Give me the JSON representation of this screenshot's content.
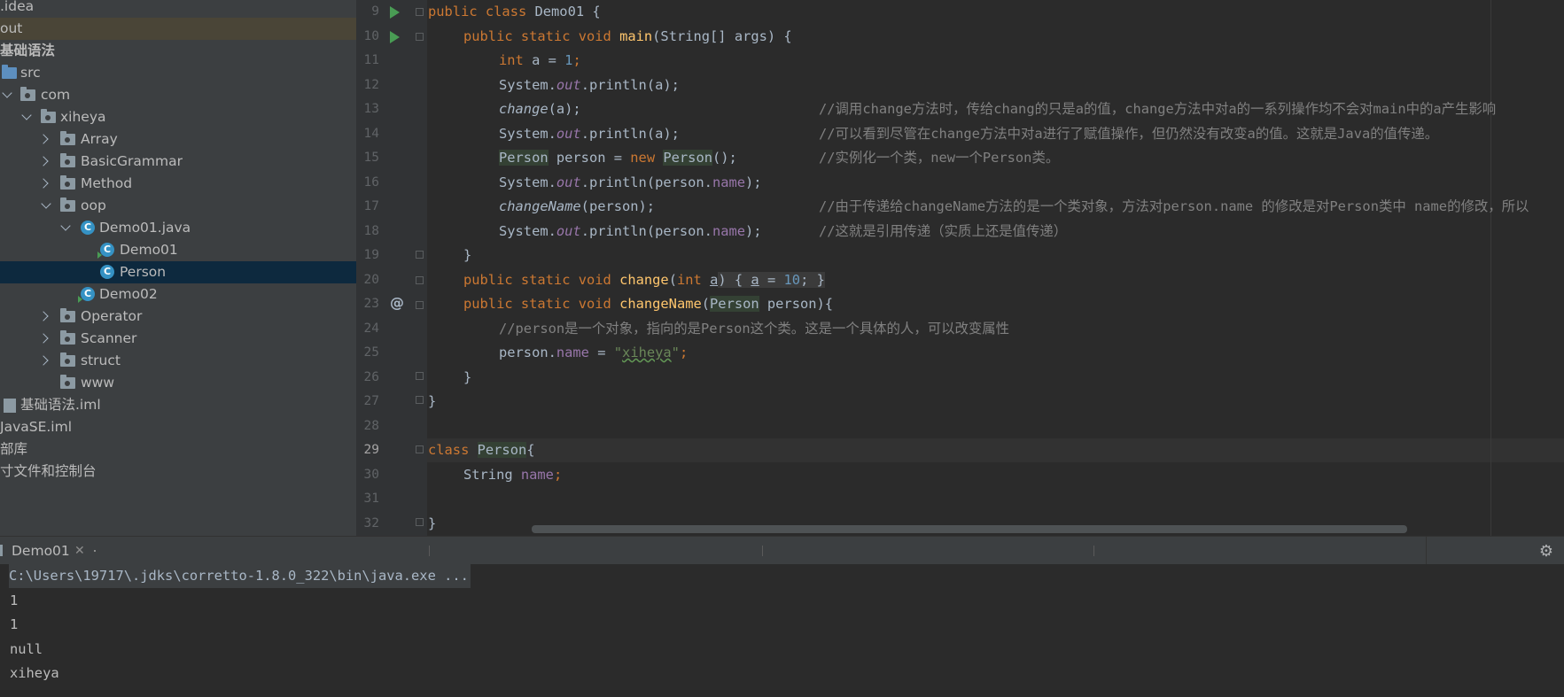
{
  "project_tree": [
    {
      "label": ".idea",
      "icon": "folder-icon",
      "indent": 0
    },
    {
      "label": "out",
      "icon": "none",
      "indent": 0,
      "highlight": "out"
    },
    {
      "label": "基础语法",
      "icon": "none",
      "indent": 0,
      "bold": true
    },
    {
      "label": "src",
      "icon": "source-folder-icon",
      "indent": 0
    },
    {
      "label": "com",
      "indent": 1
    },
    {
      "label": "xiheya",
      "indent": 2
    },
    {
      "label": "Array",
      "indent": 3
    },
    {
      "label": "BasicGrammar",
      "indent": 3
    },
    {
      "label": "Method",
      "indent": 3
    },
    {
      "label": "oop",
      "indent": 3
    },
    {
      "label": "Demo01.java",
      "indent": 4
    },
    {
      "label": "Demo01",
      "indent": 5
    },
    {
      "label": "Person",
      "indent": 5,
      "selected": true
    },
    {
      "label": "Demo02",
      "indent": 4
    },
    {
      "label": "Operator",
      "indent": 3
    },
    {
      "label": "Scanner",
      "indent": 3
    },
    {
      "label": "struct",
      "indent": 3
    },
    {
      "label": "www",
      "indent": 3
    },
    {
      "label": "基础语法.iml",
      "indent": 0
    },
    {
      "label": "JavaSE.iml",
      "indent": 0
    },
    {
      "label": "部库",
      "indent": 0
    },
    {
      "label": "寸文件和控制台",
      "indent": 0
    }
  ],
  "editor": {
    "line_numbers": [
      "9",
      "10",
      "11",
      "12",
      "13",
      "14",
      "15",
      "16",
      "17",
      "18",
      "19",
      "20",
      "23",
      "24",
      "25",
      "26",
      "27",
      "28",
      "29",
      "30",
      "31",
      "32"
    ],
    "current_line": "29",
    "code": {
      "l9": [
        "public",
        " ",
        "class",
        " Demo01 {"
      ],
      "l10": [
        "public static void",
        "main",
        "(String[] args) {"
      ],
      "l11": [
        "int",
        " a = ",
        "1",
        ";"
      ],
      "l12": [
        "System.",
        "out",
        ".println(a);"
      ],
      "l13": [
        "change",
        "(a);",
        "//调用change方法时，传给chang的只是a的值，change方法中对a的一系列操作均不会对main中的a产生影响"
      ],
      "l14": [
        "System.",
        "out",
        ".println(a);",
        "//可以看到尽管在change方法中对a进行了赋值操作，但仍然没有改变a的值。这就是Java的值传递。"
      ],
      "l15": [
        "Person",
        " person = ",
        "new",
        " ",
        "Person",
        "();",
        "//实例化一个类，new一个Person类。"
      ],
      "l16": [
        "System.",
        "out",
        ".println(person.",
        "name",
        ");"
      ],
      "l17": [
        "changeName",
        "(person);",
        "//由于传递给changeName方法的是一个类对象，方法对person.name 的修改是对Person类中 name的修改，所以"
      ],
      "l18": [
        "System.",
        "out",
        ".println(person.",
        "name",
        ");",
        "//这就是引用传递（实质上还是值传递）"
      ],
      "l19": [
        "}"
      ],
      "l20": [
        "public static void",
        "change",
        "(",
        "int",
        " ",
        "a",
        ") { ",
        "a",
        " = ",
        "10",
        "; }"
      ],
      "l23": [
        "public static void",
        "changeName",
        "(",
        "Person",
        " person){"
      ],
      "l24": [
        "//person是一个对象，指向的是Person这个类。这是一个具体的人，可以改变属性"
      ],
      "l25": [
        "person.",
        "name",
        " = ",
        "\"",
        "xiheya",
        "\"",
        ";"
      ],
      "l26": [
        "}"
      ],
      "l27": [
        "}"
      ],
      "l29": [
        "class",
        " ",
        "Person",
        "{"
      ],
      "l30": [
        "String ",
        "name",
        ";"
      ],
      "l32": [
        "}"
      ]
    }
  },
  "run_panel": {
    "tab_label": "Demo01",
    "command": "C:\\Users\\19717\\.jdks\\corretto-1.8.0_322\\bin\\java.exe ...",
    "output": [
      "1",
      "1",
      "null",
      "xiheya"
    ]
  },
  "colors": {
    "keyword": "#cc7832",
    "number": "#6897bb",
    "string": "#6a8759",
    "field": "#9876aa",
    "method": "#ffc66d",
    "comment": "#808080",
    "selection": "#0d293e"
  }
}
